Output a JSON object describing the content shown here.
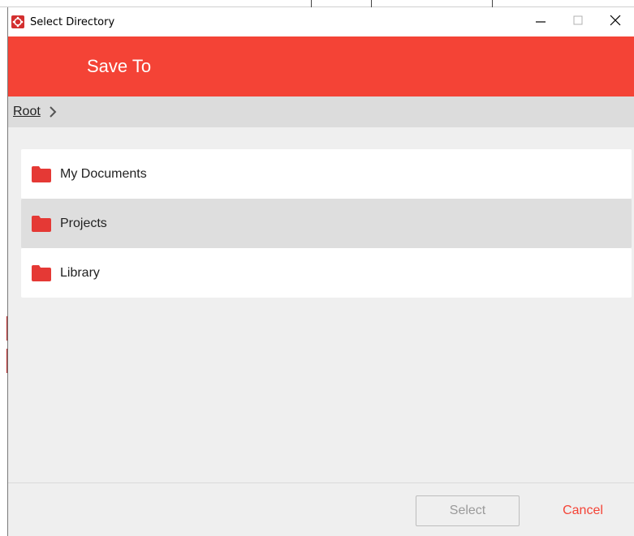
{
  "window": {
    "title": "Select Directory"
  },
  "header": {
    "title": "Save To"
  },
  "breadcrumb": {
    "root_label": "Root"
  },
  "folders": [
    {
      "label": "My Documents",
      "selected": false
    },
    {
      "label": "Projects",
      "selected": true
    },
    {
      "label": "Library",
      "selected": false
    }
  ],
  "footer": {
    "select_label": "Select",
    "cancel_label": "Cancel"
  },
  "icons": {
    "app": "app-logo-icon",
    "minimize": "minimize-icon",
    "maximize": "maximize-icon",
    "close": "close-icon",
    "chevron": "chevron-right-icon",
    "folder": "folder-icon"
  },
  "colors": {
    "accent": "#f44336",
    "folder": "#e53935",
    "selected_row": "#dedede"
  }
}
